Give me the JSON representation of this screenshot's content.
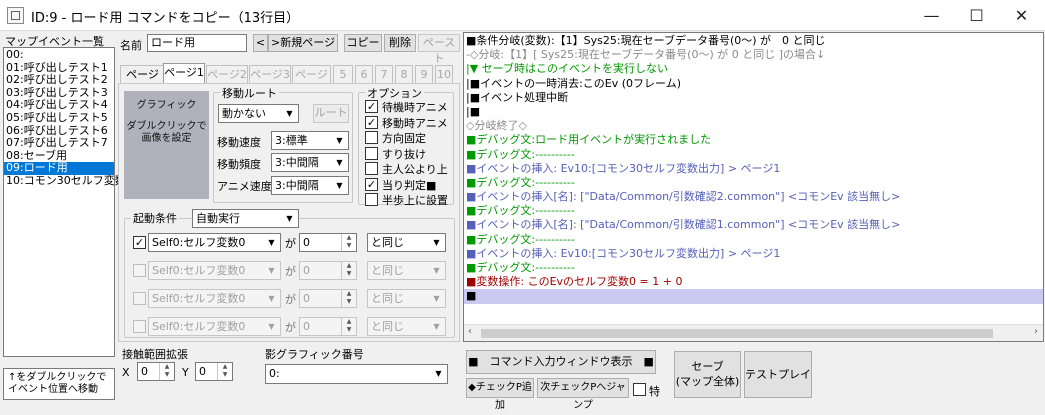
{
  "title": "ID:9 - ロード用 コマンドをコピー（13行目）",
  "window": {
    "min": "—",
    "max": "☐",
    "close": "✕"
  },
  "map_events": {
    "label": "マップイベント一覧",
    "items": [
      "00:",
      "01:呼び出しテスト1",
      "02:呼び出しテスト2",
      "03:呼び出しテスト3",
      "04:呼び出しテスト4",
      "05:呼び出しテスト5",
      "06:呼び出しテスト6",
      "07:呼び出しテスト7",
      "08:セーブ用",
      "09:ロード用",
      "10:コモン30セルフ変数"
    ],
    "selected_index": 9,
    "hint": "↑をダブルクリックで\nイベント位置へ移動"
  },
  "name_row": {
    "label": "名前",
    "value": "ロード用",
    "prev": "<",
    "next_page": ">新規ページ",
    "copy": "コピー",
    "delete": "削除",
    "paste": "ペースト"
  },
  "tabs": [
    "ページ",
    "ページ1",
    "ページ2",
    "ページ3",
    "ページ4",
    "5",
    "6",
    "7",
    "8",
    "9",
    "10"
  ],
  "tab_active": 1,
  "graphic": {
    "line1": "グラフィック",
    "line2": "ダブルクリックで",
    "line3": "画像を設定"
  },
  "move_route": {
    "label": "移動ルート",
    "type": "動かない",
    "route_button": "ルート",
    "speed_label": "移動速度",
    "speed": "3:標準",
    "freq_label": "移動頻度",
    "freq": "3:中間隔",
    "anim_label": "アニメ速度",
    "anim": "3:中間隔"
  },
  "options": {
    "label": "オプション",
    "items": [
      {
        "label": "待機時アニメ",
        "checked": true
      },
      {
        "label": "移動時アニメ",
        "checked": true
      },
      {
        "label": "方向固定",
        "checked": false
      },
      {
        "label": "すり抜け",
        "checked": false
      },
      {
        "label": "主人公より上",
        "checked": false
      },
      {
        "label": "当り判定■",
        "checked": true
      },
      {
        "label": "半歩上に設置",
        "checked": false
      }
    ]
  },
  "trigger": {
    "label": "起動条件",
    "value": "自動実行",
    "conditions": [
      {
        "enabled": true,
        "var": "Self0:セルフ変数0",
        "ga": "が",
        "num": "0",
        "op": "と同じ"
      },
      {
        "enabled": false,
        "var": "Self0:セルフ変数0",
        "ga": "が",
        "num": "0",
        "op": "と同じ"
      },
      {
        "enabled": false,
        "var": "Self0:セルフ変数0",
        "ga": "が",
        "num": "0",
        "op": "と同じ"
      },
      {
        "enabled": false,
        "var": "Self0:セルフ変数0",
        "ga": "が",
        "num": "0",
        "op": "と同じ"
      }
    ]
  },
  "contact": {
    "label": "接触範囲拡張",
    "x_label": "X",
    "x": "0",
    "y_label": "Y",
    "y": "0"
  },
  "shadow": {
    "label": "影グラフィック番号",
    "value": "0:"
  },
  "commands": [
    {
      "text": "■条件分岐(変数):【1】Sys25:現在セーブデータ番号(0〜) が　0 と同じ",
      "color": "#000000"
    },
    {
      "text": "-◇分岐:【1】[ Sys25:現在セーブデータ番号(0〜) が 0 と同じ ]の場合↓",
      "color": "#8a8a8a"
    },
    {
      "text": "|▼ セーブ時はこのイベントを実行しない",
      "color": "#009a00"
    },
    {
      "text": "|■イベントの一時消去:このEv (0フレーム)",
      "color": "#000000"
    },
    {
      "text": "|■イベント処理中断",
      "color": "#000000"
    },
    {
      "text": "|■",
      "color": "#000000"
    },
    {
      "text": "◇分岐終了◇",
      "color": "#8a8a8a"
    },
    {
      "text": "■デバッグ文:ロード用イベントが実行されました",
      "color": "#009a00"
    },
    {
      "text": "■デバッグ文:----------",
      "color": "#009a00"
    },
    {
      "text": "■イベントの挿入: Ev10:[コモン30セルフ変数出力] > ページ1",
      "color": "#5560b8"
    },
    {
      "text": "■デバッグ文:----------",
      "color": "#009a00"
    },
    {
      "text": "■イベントの挿入[名]: [\"Data/Common/引数確認2.common\"] <コモンEv 該当無し>",
      "color": "#5560b8"
    },
    {
      "text": "■デバッグ文:----------",
      "color": "#009a00"
    },
    {
      "text": "■イベントの挿入[名]: [\"Data/Common/引数確認1.common\"] <コモンEv 該当無し>",
      "color": "#5560b8"
    },
    {
      "text": "■デバッグ文:----------",
      "color": "#009a00"
    },
    {
      "text": "■イベントの挿入: Ev10:[コモン30セルフ変数出力] > ページ1",
      "color": "#5560b8"
    },
    {
      "text": "■デバッグ文:----------",
      "color": "#009a00"
    },
    {
      "text": "■変数操作: このEvのセルフ変数0 = 1 + 0",
      "color": "#a00000"
    },
    {
      "text": "■",
      "color": "#000000"
    }
  ],
  "selected_command": 18,
  "bottom": {
    "cmd_window": "■　コマンド入力ウィンドウ表示　■",
    "check_add": "◆チェックP追加",
    "next_check": "次チェックPへジャンプ",
    "special": "特",
    "save": "セーブ\n(マップ全体)",
    "test": "テストプレイ"
  }
}
